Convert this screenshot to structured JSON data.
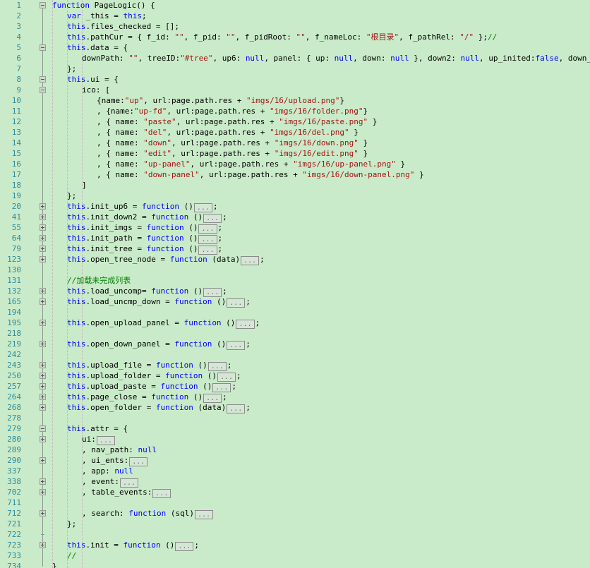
{
  "editor": {
    "name": "code-editor",
    "language": "javascript",
    "background_color": "#c9ebc9",
    "line_number_color": "#2e8b9c",
    "keyword_color": "#0000ff",
    "string_color": "#a31515",
    "comment_color": "#008000",
    "plain_color": "#000000",
    "collapsed_placeholder": "...",
    "total_visible_lines": 52
  },
  "lines": [
    {
      "num": "1",
      "indent": 0,
      "fold": "minus",
      "tokens": [
        {
          "t": "kw",
          "v": "function"
        },
        {
          "t": "pln",
          "v": " PageLogic() {"
        }
      ]
    },
    {
      "num": "2",
      "indent": 1,
      "fold": "line",
      "tokens": [
        {
          "t": "kw",
          "v": "var"
        },
        {
          "t": "pln",
          "v": " _this = "
        },
        {
          "t": "kw",
          "v": "this"
        },
        {
          "t": "pln",
          "v": ";"
        }
      ]
    },
    {
      "num": "3",
      "indent": 1,
      "fold": "line",
      "tokens": [
        {
          "t": "kw",
          "v": "this"
        },
        {
          "t": "pln",
          "v": ".files_checked = [];"
        }
      ]
    },
    {
      "num": "4",
      "indent": 1,
      "fold": "line",
      "tokens": [
        {
          "t": "kw",
          "v": "this"
        },
        {
          "t": "pln",
          "v": ".pathCur = { f_id: "
        },
        {
          "t": "str",
          "v": "\"\""
        },
        {
          "t": "pln",
          "v": ", f_pid: "
        },
        {
          "t": "str",
          "v": "\"\""
        },
        {
          "t": "pln",
          "v": ", f_pidRoot: "
        },
        {
          "t": "str",
          "v": "\"\""
        },
        {
          "t": "pln",
          "v": ", f_nameLoc: "
        },
        {
          "t": "str",
          "v": "\"根目录\""
        },
        {
          "t": "pln",
          "v": ", f_pathRel: "
        },
        {
          "t": "str",
          "v": "\"/\""
        },
        {
          "t": "pln",
          "v": " };"
        },
        {
          "t": "cmt",
          "v": "//"
        }
      ]
    },
    {
      "num": "5",
      "indent": 1,
      "fold": "minus",
      "tokens": [
        {
          "t": "kw",
          "v": "this"
        },
        {
          "t": "pln",
          "v": ".data = {"
        }
      ]
    },
    {
      "num": "6",
      "indent": 2,
      "fold": "line",
      "tokens": [
        {
          "t": "pln",
          "v": "downPath: "
        },
        {
          "t": "str",
          "v": "\"\""
        },
        {
          "t": "pln",
          "v": ", treeID:"
        },
        {
          "t": "str",
          "v": "\"#tree\""
        },
        {
          "t": "pln",
          "v": ", up6: "
        },
        {
          "t": "kw",
          "v": "null"
        },
        {
          "t": "pln",
          "v": ", panel: { up: "
        },
        {
          "t": "kw",
          "v": "null"
        },
        {
          "t": "pln",
          "v": ", down: "
        },
        {
          "t": "kw",
          "v": "null"
        },
        {
          "t": "pln",
          "v": " }, down2: "
        },
        {
          "t": "kw",
          "v": "null"
        },
        {
          "t": "pln",
          "v": ", up_inited:"
        },
        {
          "t": "kw",
          "v": "false"
        },
        {
          "t": "pln",
          "v": ", down_inited:"
        },
        {
          "t": "kw",
          "v": "false"
        }
      ]
    },
    {
      "num": "7",
      "indent": 1,
      "fold": "line",
      "tokens": [
        {
          "t": "pln",
          "v": "};"
        }
      ]
    },
    {
      "num": "8",
      "indent": 1,
      "fold": "minus",
      "tokens": [
        {
          "t": "kw",
          "v": "this"
        },
        {
          "t": "pln",
          "v": ".ui = {"
        }
      ]
    },
    {
      "num": "9",
      "indent": 2,
      "fold": "minus",
      "tokens": [
        {
          "t": "pln",
          "v": "ico: ["
        }
      ]
    },
    {
      "num": "10",
      "indent": 3,
      "fold": "line",
      "tokens": [
        {
          "t": "pln",
          "v": "{name:"
        },
        {
          "t": "str",
          "v": "\"up\""
        },
        {
          "t": "pln",
          "v": ", url:page.path.res + "
        },
        {
          "t": "str",
          "v": "\"imgs/16/upload.png\""
        },
        {
          "t": "pln",
          "v": "}"
        }
      ]
    },
    {
      "num": "11",
      "indent": 3,
      "fold": "line",
      "tokens": [
        {
          "t": "pln",
          "v": ", {name:"
        },
        {
          "t": "str",
          "v": "\"up-fd\""
        },
        {
          "t": "pln",
          "v": ", url:page.path.res + "
        },
        {
          "t": "str",
          "v": "\"imgs/16/folder.png\""
        },
        {
          "t": "pln",
          "v": "}"
        }
      ]
    },
    {
      "num": "12",
      "indent": 3,
      "fold": "line",
      "tokens": [
        {
          "t": "pln",
          "v": ", { name: "
        },
        {
          "t": "str",
          "v": "\"paste\""
        },
        {
          "t": "pln",
          "v": ", url:page.path.res + "
        },
        {
          "t": "str",
          "v": "\"imgs/16/paste.png\""
        },
        {
          "t": "pln",
          "v": " }"
        }
      ]
    },
    {
      "num": "13",
      "indent": 3,
      "fold": "line",
      "tokens": [
        {
          "t": "pln",
          "v": ", { name: "
        },
        {
          "t": "str",
          "v": "\"del\""
        },
        {
          "t": "pln",
          "v": ", url:page.path.res + "
        },
        {
          "t": "str",
          "v": "\"imgs/16/del.png\""
        },
        {
          "t": "pln",
          "v": " }"
        }
      ]
    },
    {
      "num": "14",
      "indent": 3,
      "fold": "line",
      "tokens": [
        {
          "t": "pln",
          "v": ", { name: "
        },
        {
          "t": "str",
          "v": "\"down\""
        },
        {
          "t": "pln",
          "v": ", url:page.path.res + "
        },
        {
          "t": "str",
          "v": "\"imgs/16/down.png\""
        },
        {
          "t": "pln",
          "v": " }"
        }
      ]
    },
    {
      "num": "15",
      "indent": 3,
      "fold": "line",
      "tokens": [
        {
          "t": "pln",
          "v": ", { name: "
        },
        {
          "t": "str",
          "v": "\"edit\""
        },
        {
          "t": "pln",
          "v": ", url:page.path.res + "
        },
        {
          "t": "str",
          "v": "\"imgs/16/edit.png\""
        },
        {
          "t": "pln",
          "v": " }"
        }
      ]
    },
    {
      "num": "16",
      "indent": 3,
      "fold": "line",
      "tokens": [
        {
          "t": "pln",
          "v": ", { name: "
        },
        {
          "t": "str",
          "v": "\"up-panel\""
        },
        {
          "t": "pln",
          "v": ", url:page.path.res + "
        },
        {
          "t": "str",
          "v": "\"imgs/16/up-panel.png\""
        },
        {
          "t": "pln",
          "v": " }"
        }
      ]
    },
    {
      "num": "17",
      "indent": 3,
      "fold": "line",
      "tokens": [
        {
          "t": "pln",
          "v": ", { name: "
        },
        {
          "t": "str",
          "v": "\"down-panel\""
        },
        {
          "t": "pln",
          "v": ", url:page.path.res + "
        },
        {
          "t": "str",
          "v": "\"imgs/16/down-panel.png\""
        },
        {
          "t": "pln",
          "v": " }"
        }
      ]
    },
    {
      "num": "18",
      "indent": 2,
      "fold": "line",
      "tokens": [
        {
          "t": "pln",
          "v": "]"
        }
      ]
    },
    {
      "num": "19",
      "indent": 1,
      "fold": "line",
      "tokens": [
        {
          "t": "pln",
          "v": "};"
        }
      ]
    },
    {
      "num": "20",
      "indent": 1,
      "fold": "plus",
      "tokens": [
        {
          "t": "kw",
          "v": "this"
        },
        {
          "t": "pln",
          "v": ".init_up6 = "
        },
        {
          "t": "kw",
          "v": "function"
        },
        {
          "t": "pln",
          "v": " ()"
        },
        {
          "t": "box",
          "v": "..."
        },
        {
          "t": "pln",
          "v": ";"
        }
      ]
    },
    {
      "num": "41",
      "indent": 1,
      "fold": "plus",
      "tokens": [
        {
          "t": "kw",
          "v": "this"
        },
        {
          "t": "pln",
          "v": ".init_down2 = "
        },
        {
          "t": "kw",
          "v": "function"
        },
        {
          "t": "pln",
          "v": " ()"
        },
        {
          "t": "box",
          "v": "..."
        },
        {
          "t": "pln",
          "v": ";"
        }
      ]
    },
    {
      "num": "55",
      "indent": 1,
      "fold": "plus",
      "tokens": [
        {
          "t": "kw",
          "v": "this"
        },
        {
          "t": "pln",
          "v": ".init_imgs = "
        },
        {
          "t": "kw",
          "v": "function"
        },
        {
          "t": "pln",
          "v": " ()"
        },
        {
          "t": "box",
          "v": "..."
        },
        {
          "t": "pln",
          "v": ";"
        }
      ]
    },
    {
      "num": "64",
      "indent": 1,
      "fold": "plus",
      "tokens": [
        {
          "t": "kw",
          "v": "this"
        },
        {
          "t": "pln",
          "v": ".init_path = "
        },
        {
          "t": "kw",
          "v": "function"
        },
        {
          "t": "pln",
          "v": " ()"
        },
        {
          "t": "box",
          "v": "..."
        },
        {
          "t": "pln",
          "v": ";"
        }
      ]
    },
    {
      "num": "79",
      "indent": 1,
      "fold": "plus",
      "tokens": [
        {
          "t": "kw",
          "v": "this"
        },
        {
          "t": "pln",
          "v": ".init_tree = "
        },
        {
          "t": "kw",
          "v": "function"
        },
        {
          "t": "pln",
          "v": " ()"
        },
        {
          "t": "box",
          "v": "..."
        },
        {
          "t": "pln",
          "v": ";"
        }
      ]
    },
    {
      "num": "123",
      "indent": 1,
      "fold": "plus",
      "tokens": [
        {
          "t": "kw",
          "v": "this"
        },
        {
          "t": "pln",
          "v": ".open_tree_node = "
        },
        {
          "t": "kw",
          "v": "function"
        },
        {
          "t": "pln",
          "v": " (data)"
        },
        {
          "t": "box",
          "v": "..."
        },
        {
          "t": "pln",
          "v": ";"
        }
      ]
    },
    {
      "num": "130",
      "indent": 1,
      "fold": "line",
      "tokens": []
    },
    {
      "num": "131",
      "indent": 1,
      "fold": "line",
      "tokens": [
        {
          "t": "cmt",
          "v": "//加载未完成列表"
        }
      ]
    },
    {
      "num": "132",
      "indent": 1,
      "fold": "plus",
      "tokens": [
        {
          "t": "kw",
          "v": "this"
        },
        {
          "t": "pln",
          "v": ".load_uncomp= "
        },
        {
          "t": "kw",
          "v": "function"
        },
        {
          "t": "pln",
          "v": " ()"
        },
        {
          "t": "box",
          "v": "..."
        },
        {
          "t": "pln",
          "v": ";"
        }
      ]
    },
    {
      "num": "165",
      "indent": 1,
      "fold": "plus",
      "tokens": [
        {
          "t": "kw",
          "v": "this"
        },
        {
          "t": "pln",
          "v": ".load_uncmp_down = "
        },
        {
          "t": "kw",
          "v": "function"
        },
        {
          "t": "pln",
          "v": " ()"
        },
        {
          "t": "box",
          "v": "..."
        },
        {
          "t": "pln",
          "v": ";"
        }
      ]
    },
    {
      "num": "194",
      "indent": 1,
      "fold": "line",
      "tokens": []
    },
    {
      "num": "195",
      "indent": 1,
      "fold": "plus",
      "tokens": [
        {
          "t": "kw",
          "v": "this"
        },
        {
          "t": "pln",
          "v": ".open_upload_panel = "
        },
        {
          "t": "kw",
          "v": "function"
        },
        {
          "t": "pln",
          "v": " ()"
        },
        {
          "t": "box",
          "v": "..."
        },
        {
          "t": "pln",
          "v": ";"
        }
      ]
    },
    {
      "num": "218",
      "indent": 1,
      "fold": "line",
      "tokens": []
    },
    {
      "num": "219",
      "indent": 1,
      "fold": "plus",
      "tokens": [
        {
          "t": "kw",
          "v": "this"
        },
        {
          "t": "pln",
          "v": ".open_down_panel = "
        },
        {
          "t": "kw",
          "v": "function"
        },
        {
          "t": "pln",
          "v": " ()"
        },
        {
          "t": "box",
          "v": "..."
        },
        {
          "t": "pln",
          "v": ";"
        }
      ]
    },
    {
      "num": "242",
      "indent": 1,
      "fold": "line",
      "tokens": []
    },
    {
      "num": "243",
      "indent": 1,
      "fold": "plus",
      "tokens": [
        {
          "t": "kw",
          "v": "this"
        },
        {
          "t": "pln",
          "v": ".upload_file = "
        },
        {
          "t": "kw",
          "v": "function"
        },
        {
          "t": "pln",
          "v": " ()"
        },
        {
          "t": "box",
          "v": "..."
        },
        {
          "t": "pln",
          "v": ";"
        }
      ]
    },
    {
      "num": "250",
      "indent": 1,
      "fold": "plus",
      "tokens": [
        {
          "t": "kw",
          "v": "this"
        },
        {
          "t": "pln",
          "v": ".upload_folder = "
        },
        {
          "t": "kw",
          "v": "function"
        },
        {
          "t": "pln",
          "v": " ()"
        },
        {
          "t": "box",
          "v": "..."
        },
        {
          "t": "pln",
          "v": ";"
        }
      ]
    },
    {
      "num": "257",
      "indent": 1,
      "fold": "plus",
      "tokens": [
        {
          "t": "kw",
          "v": "this"
        },
        {
          "t": "pln",
          "v": ".upload_paste = "
        },
        {
          "t": "kw",
          "v": "function"
        },
        {
          "t": "pln",
          "v": " ()"
        },
        {
          "t": "box",
          "v": "..."
        },
        {
          "t": "pln",
          "v": ";"
        }
      ]
    },
    {
      "num": "264",
      "indent": 1,
      "fold": "plus",
      "tokens": [
        {
          "t": "kw",
          "v": "this"
        },
        {
          "t": "pln",
          "v": ".page_close = "
        },
        {
          "t": "kw",
          "v": "function"
        },
        {
          "t": "pln",
          "v": " ()"
        },
        {
          "t": "box",
          "v": "..."
        },
        {
          "t": "pln",
          "v": ";"
        }
      ]
    },
    {
      "num": "268",
      "indent": 1,
      "fold": "plus",
      "tokens": [
        {
          "t": "kw",
          "v": "this"
        },
        {
          "t": "pln",
          "v": ".open_folder = "
        },
        {
          "t": "kw",
          "v": "function"
        },
        {
          "t": "pln",
          "v": " (data)"
        },
        {
          "t": "box",
          "v": "..."
        },
        {
          "t": "pln",
          "v": ";"
        }
      ]
    },
    {
      "num": "278",
      "indent": 1,
      "fold": "line",
      "tokens": []
    },
    {
      "num": "279",
      "indent": 1,
      "fold": "minus",
      "tokens": [
        {
          "t": "kw",
          "v": "this"
        },
        {
          "t": "pln",
          "v": ".attr = {"
        }
      ]
    },
    {
      "num": "280",
      "indent": 2,
      "fold": "plus",
      "tokens": [
        {
          "t": "pln",
          "v": "ui:"
        },
        {
          "t": "box",
          "v": "..."
        }
      ]
    },
    {
      "num": "289",
      "indent": 2,
      "fold": "line",
      "tokens": [
        {
          "t": "pln",
          "v": ", nav_path: "
        },
        {
          "t": "kw",
          "v": "null"
        }
      ]
    },
    {
      "num": "290",
      "indent": 2,
      "fold": "plus",
      "tokens": [
        {
          "t": "pln",
          "v": ", ui_ents:"
        },
        {
          "t": "box",
          "v": "..."
        }
      ]
    },
    {
      "num": "337",
      "indent": 2,
      "fold": "line",
      "tokens": [
        {
          "t": "pln",
          "v": ", app: "
        },
        {
          "t": "kw",
          "v": "null"
        }
      ]
    },
    {
      "num": "338",
      "indent": 2,
      "fold": "plus",
      "tokens": [
        {
          "t": "pln",
          "v": ", event:"
        },
        {
          "t": "box",
          "v": "..."
        }
      ]
    },
    {
      "num": "702",
      "indent": 2,
      "fold": "plus",
      "tokens": [
        {
          "t": "pln",
          "v": ", table_events:"
        },
        {
          "t": "box",
          "v": "..."
        }
      ]
    },
    {
      "num": "711",
      "indent": 2,
      "fold": "line",
      "tokens": []
    },
    {
      "num": "712",
      "indent": 2,
      "fold": "plus",
      "tokens": [
        {
          "t": "pln",
          "v": ", search: "
        },
        {
          "t": "kw",
          "v": "function"
        },
        {
          "t": "pln",
          "v": " (sql)"
        },
        {
          "t": "box",
          "v": "..."
        }
      ]
    },
    {
      "num": "721",
      "indent": 1,
      "fold": "line",
      "tokens": [
        {
          "t": "pln",
          "v": "};"
        }
      ]
    },
    {
      "num": "722",
      "indent": 1,
      "fold": "tick",
      "tokens": []
    },
    {
      "num": "723",
      "indent": 1,
      "fold": "plus",
      "tokens": [
        {
          "t": "kw",
          "v": "this"
        },
        {
          "t": "pln",
          "v": ".init = "
        },
        {
          "t": "kw",
          "v": "function"
        },
        {
          "t": "pln",
          "v": " ()"
        },
        {
          "t": "box",
          "v": "..."
        },
        {
          "t": "pln",
          "v": ";"
        }
      ]
    },
    {
      "num": "733",
      "indent": 1,
      "fold": "line",
      "tokens": [
        {
          "t": "cmt",
          "v": "//"
        }
      ]
    },
    {
      "num": "734",
      "indent": 0,
      "fold": "line",
      "tokens": [
        {
          "t": "pln",
          "v": "}"
        }
      ]
    }
  ]
}
